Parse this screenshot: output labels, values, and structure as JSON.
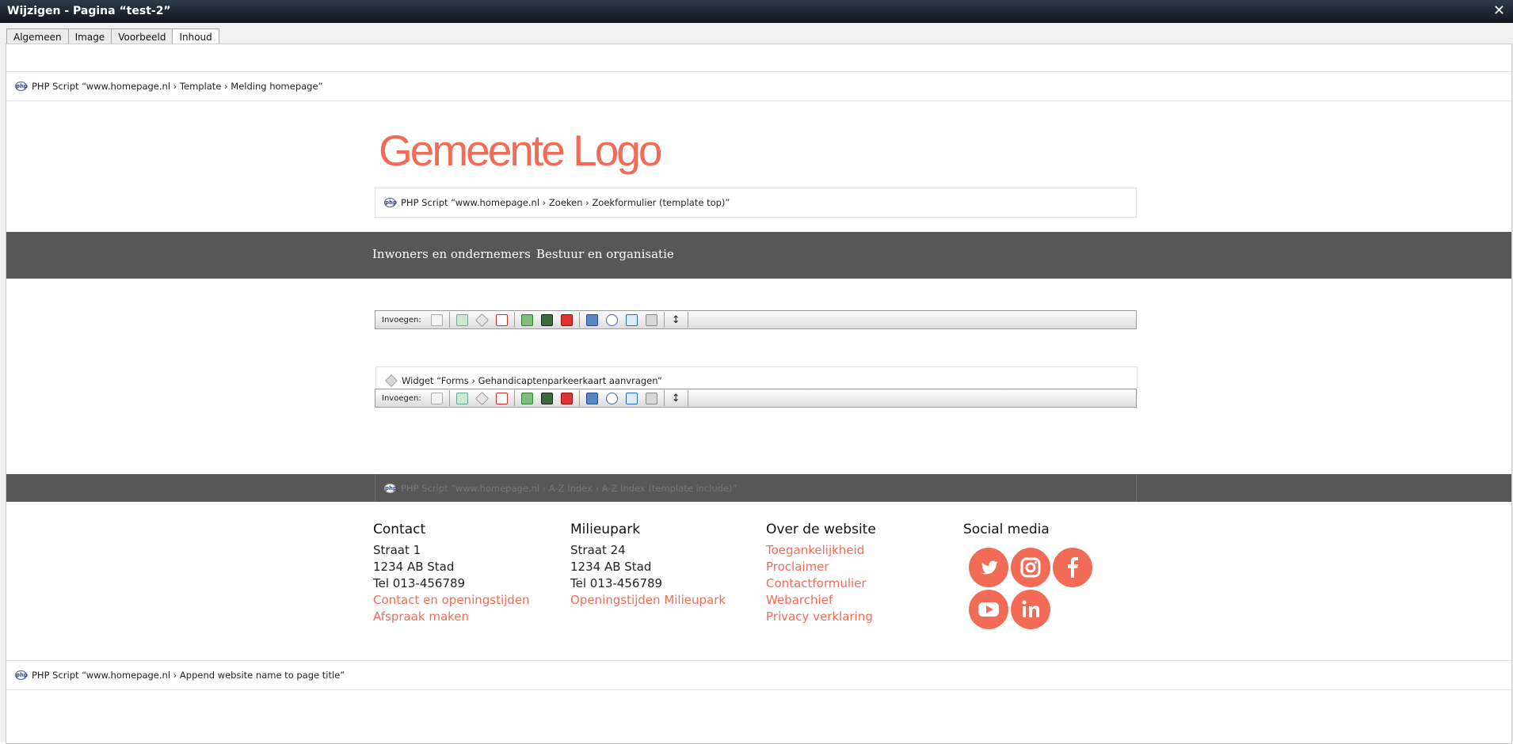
{
  "window": {
    "title": "Wijzigen - Pagina “test-2”",
    "close_glyph": "✕"
  },
  "tabs": [
    {
      "label": "Algemeen"
    },
    {
      "label": "Image"
    },
    {
      "label": "Voorbeeld"
    },
    {
      "label": "Inhoud"
    }
  ],
  "script_top": {
    "text": "PHP Script “www.homepage.nl › Template › Melding homepage”"
  },
  "logo": {
    "text": "Gemeente Logo"
  },
  "search_script": {
    "text": "PHP Script “www.homepage.nl ›   Zoeken › Zoekformulier (template top)”"
  },
  "nav": {
    "items": [
      {
        "label": "Inwoners en ondernemers"
      },
      {
        "label": "Bestuur en organisatie"
      }
    ]
  },
  "toolbar": {
    "label": "Invoegen:"
  },
  "widget": {
    "text": "Widget “Forms › Gehandicaptenparkeerkaart aanvragen”"
  },
  "az_script": {
    "text": "PHP Script “www.homepage.nl › A-Z Index › A-Z Index (template include)”"
  },
  "footer": {
    "contact": {
      "heading": "Contact",
      "lines": [
        "Straat 1",
        "1234 AB  Stad",
        "Tel 013-456789"
      ],
      "links": [
        "Contact en openingstijden",
        "Afspraak maken"
      ]
    },
    "milieupark": {
      "heading": "Milieupark",
      "lines": [
        "Straat 24",
        "1234 AB  Stad",
        "Tel 013-456789"
      ],
      "links": [
        "Openingstijden Milieupark"
      ]
    },
    "website": {
      "heading": "Over de website",
      "links": [
        "Toegankelijkheid",
        "Proclaimer",
        "Contactformulier",
        "Webarchief",
        "Privacy verklaring"
      ]
    },
    "social": {
      "heading": "Social media",
      "icons": [
        "twitter-icon",
        "instagram-icon",
        "facebook-icon",
        "youtube-icon",
        "linkedin-icon"
      ]
    }
  },
  "script_bottom": {
    "text": "PHP Script “www.homepage.nl › Append website name to page title”"
  },
  "colors": {
    "accent": "#f26b57",
    "nav_bg": "#585758",
    "titlebar": "#1c2430"
  }
}
